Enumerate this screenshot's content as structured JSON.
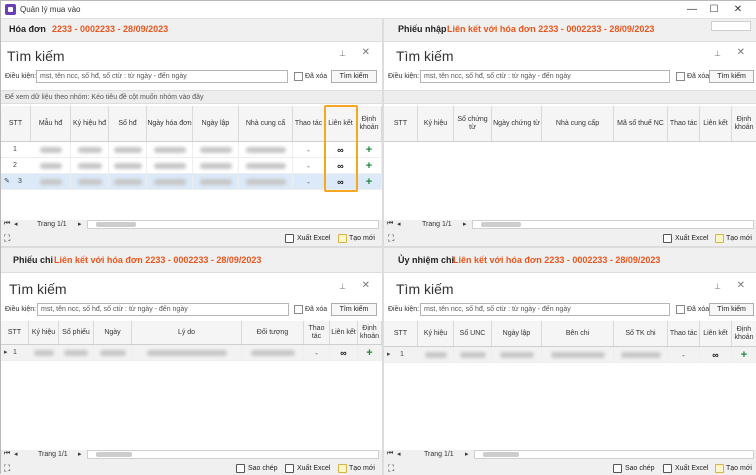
{
  "window": {
    "title": "Quản lý mua vào",
    "min": "—",
    "max": "☐",
    "close": "✕"
  },
  "common": {
    "search_title": "Tìm kiếm",
    "condition_label": "Điều kiện:",
    "condition_placeholder": "mst, tên ncc, số hđ, số ctừ : từ ngày - đến ngày",
    "deleted_label": "Đã xóa",
    "search_button": "Tìm kiếm",
    "page_label": "Trang 1/1",
    "export_excel": "Xuất Excel",
    "new": "Tạo mới",
    "copy": "Sao chép",
    "group_hint": "Để xem dữ liệu theo nhóm: Kéo tiêu đề cột muốn nhóm vào đây",
    "pin_icon": "pin-icon",
    "close_icon": "close-icon"
  },
  "hoadon": {
    "title": "Hóa đơn",
    "link_text": "2233 - 0002233 - 28/09/2023",
    "columns": [
      "STT",
      "Mẫu hđ",
      "Ký hiệu hđ",
      "Số hđ",
      "Ngày hóa đơn",
      "Ngày lập",
      "Nhà cung cấ",
      "Thao tác",
      "Liên kết",
      "Định khoản"
    ],
    "rows": [
      "1",
      "2",
      "3"
    ]
  },
  "phieunhap": {
    "title": "Phiếu nhập",
    "link_text": "Liên kết với hóa đơn 2233 - 0002233 - 28/09/2023",
    "columns": [
      "STT",
      "Ký hiệu",
      "Số chứng từ",
      "Ngày chứng từ",
      "Nhà cung cấp",
      "Mã số thuế NC",
      "Thao tác",
      "Liên kết",
      "Định khoản"
    ]
  },
  "phieuchi": {
    "title": "Phiếu chi",
    "link_text": "Liên kết với hóa đơn 2233 - 0002233 - 28/09/2023",
    "columns": [
      "STT",
      "Ký hiệu",
      "Số phiếu",
      "Ngày",
      "Lý do",
      "Đối tượng",
      "Thao tác",
      "Liên kết",
      "Định khoản"
    ],
    "rows": [
      "1"
    ]
  },
  "uynhiemchi": {
    "title": "Ủy nhiệm chi",
    "link_text": "Liên kết với hóa đơn 2233 - 0002233 - 28/09/2023",
    "columns": [
      "STT",
      "Ký hiệu",
      "Số UNC",
      "Ngày lập",
      "Bên chi",
      "Số TK chi",
      "Thao tác",
      "Liên kết",
      "Định khoản"
    ],
    "rows": [
      "1"
    ]
  },
  "colors": {
    "accent": "#e8561e",
    "highlight": "#f5a623",
    "plus": "#1a8a3a"
  }
}
